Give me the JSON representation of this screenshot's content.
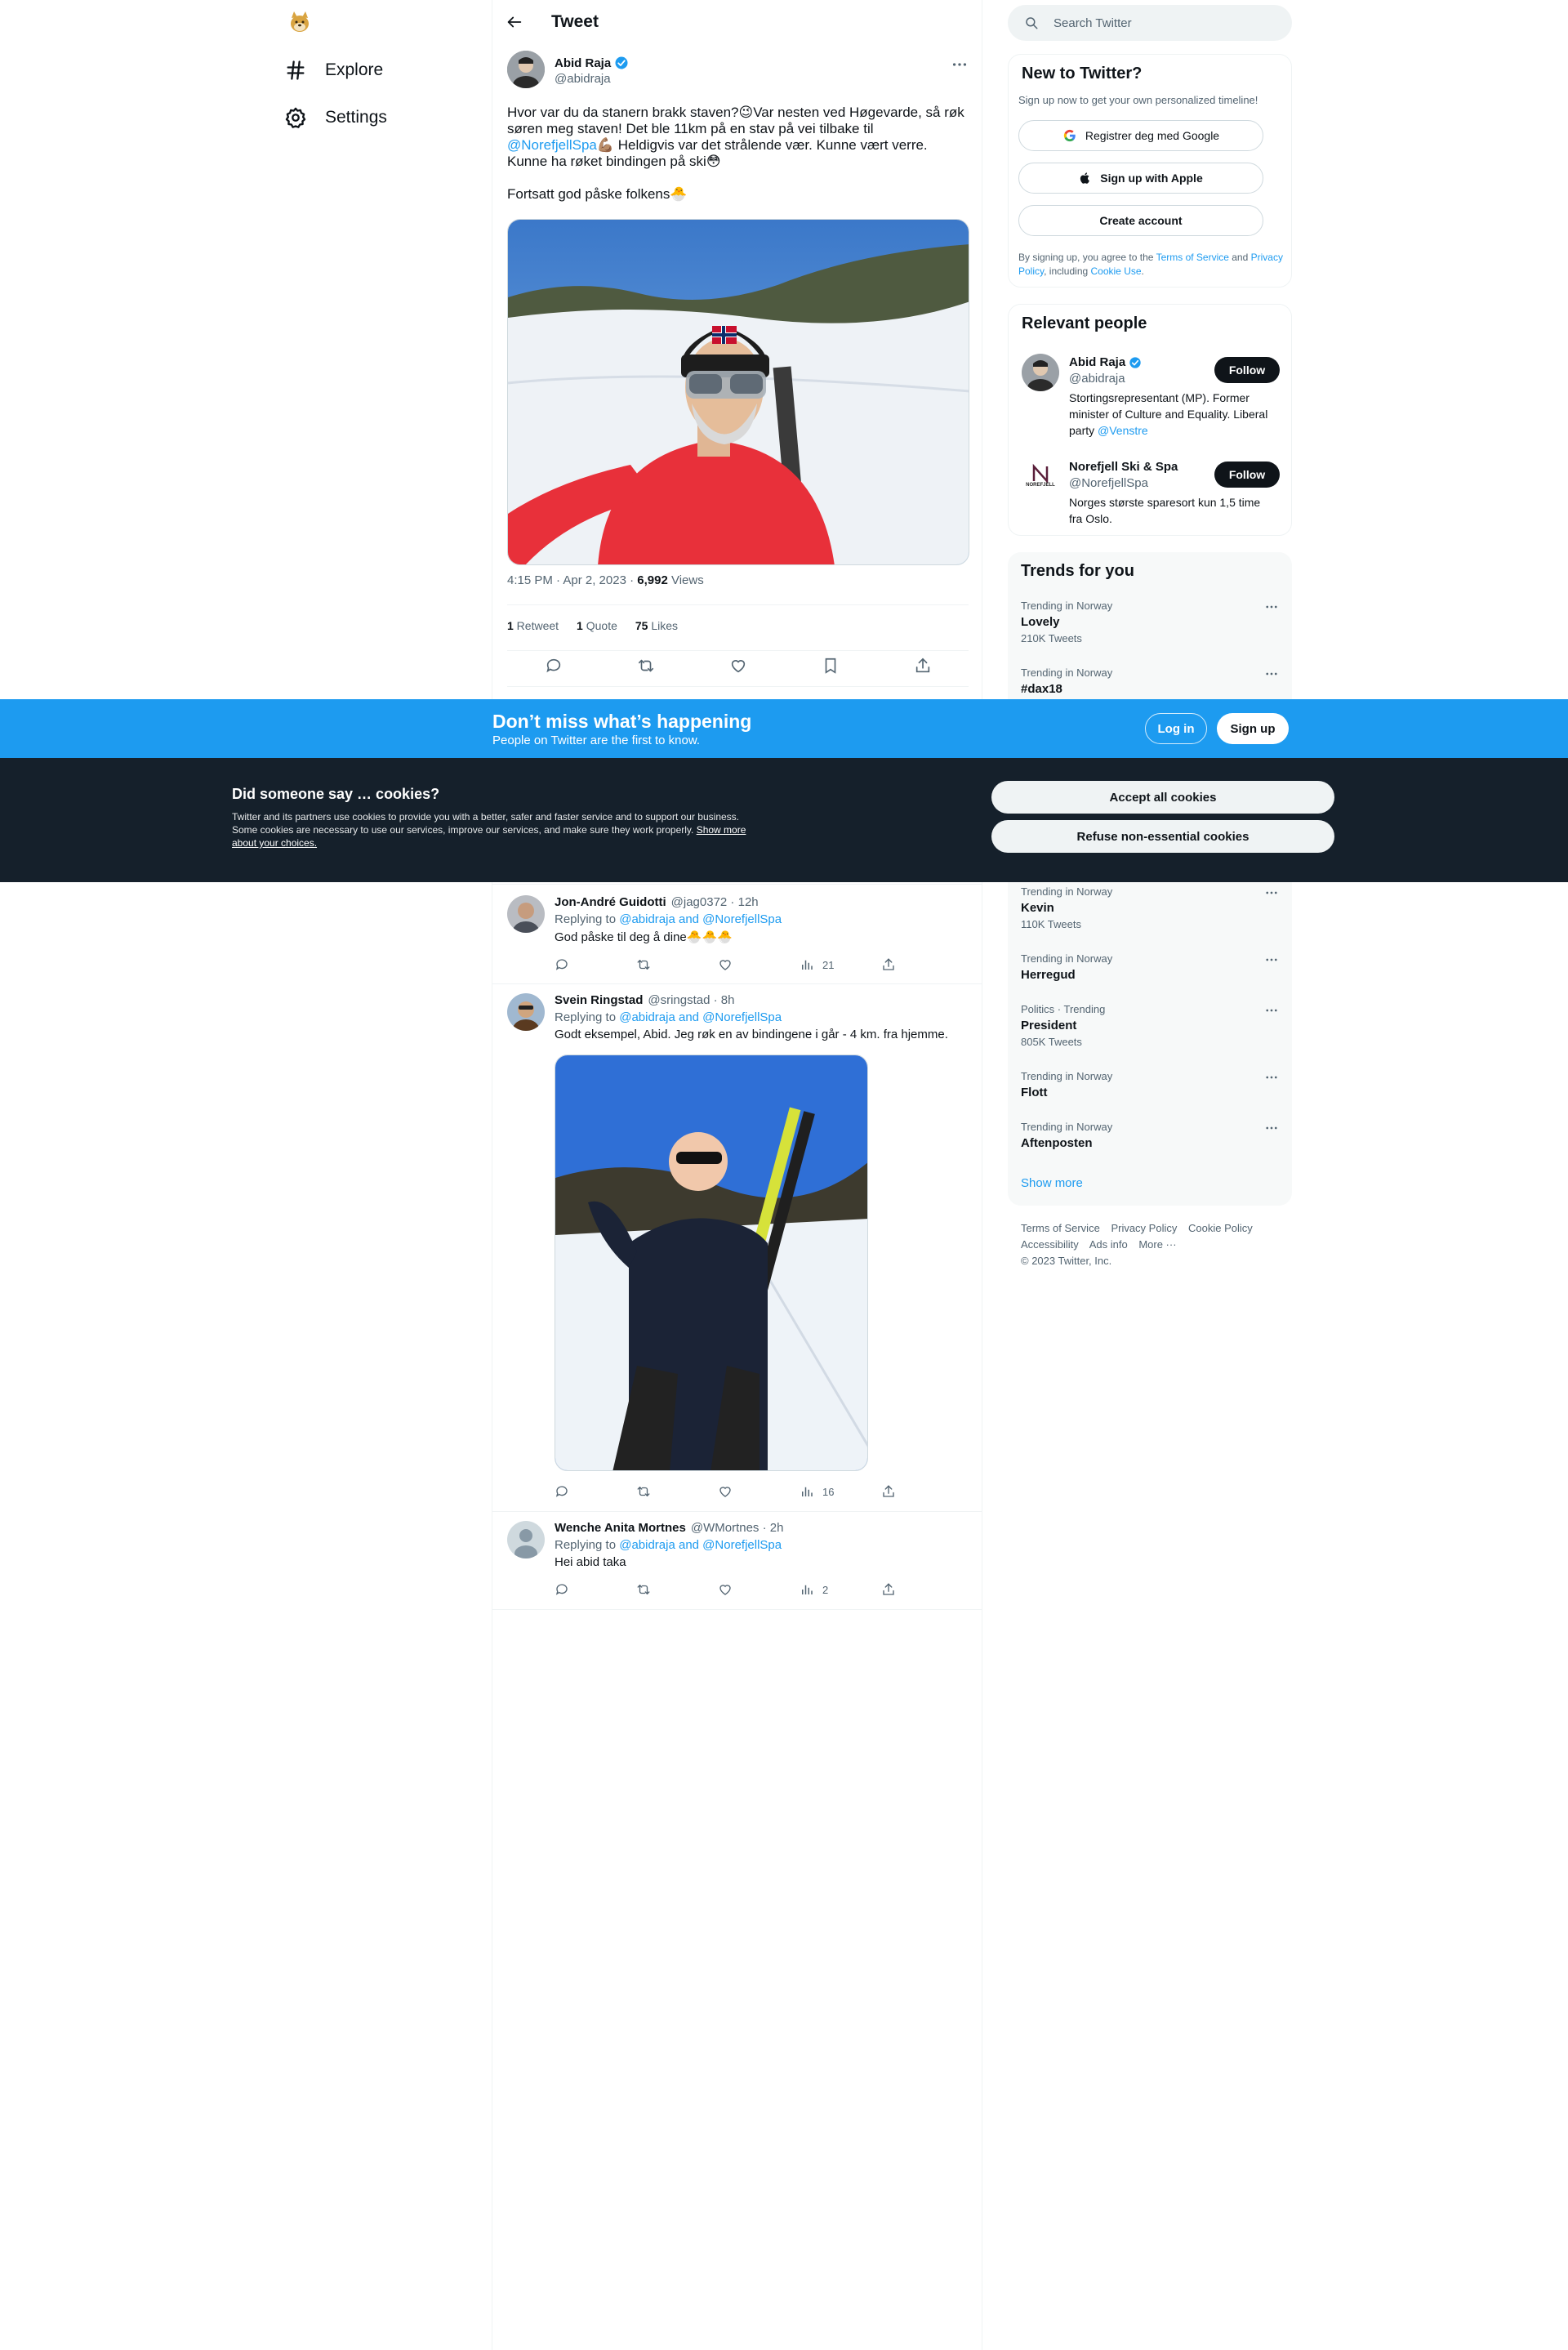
{
  "nav": {
    "explore": "Explore",
    "settings": "Settings"
  },
  "header": {
    "title": "Tweet"
  },
  "tweet": {
    "author_name": "Abid Raja",
    "author_handle": "@abidraja",
    "text_line1": "Hvor var du da stanern brakk staven?😉Var nesten ved Høgevarde, så røk søren meg staven! Det ble 11km på en stav på vei tilbake til",
    "mention": "@NorefjellSpa",
    "text_line2": "💪🏽 Heldigvis var det strålende vær. Kunne vært verre. Kunne ha røket bindingen på ski😳",
    "text_para2": "Fortsatt god påske folkens🐣",
    "timestamp": "4:15 PM · Apr 2, 2023 · ",
    "views_count": "6,992",
    "views_label": " Views",
    "retweets_count": "1",
    "retweets_label": " Retweet",
    "quotes_count": "1",
    "quotes_label": " Quote",
    "likes_count": "75",
    "likes_label": " Likes"
  },
  "replies": [
    {
      "name": "Jon-André Guidotti",
      "handle": "@jag0372 · 12h",
      "replying_prefix": "Replying to ",
      "replying_to": "@abidraja and @NorefjellSpa",
      "text": "God påske til deg å dine🐣🐣🐣",
      "views": "21"
    },
    {
      "name": "Svein Ringstad",
      "handle": "@sringstad · 8h",
      "replying_prefix": "Replying to ",
      "replying_to": "@abidraja and @NorefjellSpa",
      "text": "Godt eksempel, Abid. Jeg røk en av bindingene i går - 4 km. fra hjemme.",
      "views": "16"
    },
    {
      "name": "Wenche Anita Mortnes",
      "handle": "@WMortnes · 2h",
      "replying_prefix": "Replying to ",
      "replying_to": "@abidraja and @NorefjellSpa",
      "text": "Hei abid taka",
      "views": "2"
    }
  ],
  "search": {
    "placeholder": "Search Twitter"
  },
  "new_to_twitter": {
    "title": "New to Twitter?",
    "subtitle": "Sign up now to get your own personalized timeline!",
    "google": "Registrer deg med Google",
    "apple": "Sign up with Apple",
    "create": "Create account",
    "legal_prefix": "By signing up, you agree to the ",
    "terms": "Terms of Service",
    "and": " and ",
    "privacy": "Privacy Policy",
    "including": ", including ",
    "cookie": "Cookie Use",
    "period": "."
  },
  "relevant_people": {
    "title": "Relevant people",
    "people": [
      {
        "name": "Abid Raja",
        "handle": "@abidraja",
        "bio": "Stortingsrepresentant (MP). Former minister of Culture and Equality. Liberal party ",
        "bio_link": "@Venstre",
        "follow": "Follow"
      },
      {
        "name": "Norefjell Ski & Spa",
        "handle": "@NorefjellSpa",
        "bio": "Norges største sparesort kun 1,5 time fra Oslo.",
        "logo_text": "NOREFJELL",
        "follow": "Follow"
      }
    ]
  },
  "trends": {
    "title": "Trends for you",
    "items": [
      {
        "context": "Trending in Norway",
        "name": "Lovely",
        "count": "210K Tweets"
      },
      {
        "context": "Trending in Norway",
        "name": "#dax18",
        "count": ""
      },
      {
        "context": "Trending in Norway",
        "name": "Kevin",
        "count": "110K Tweets"
      },
      {
        "context": "Trending in Norway",
        "name": "Herregud",
        "count": ""
      },
      {
        "context": "Politics · Trending",
        "name": "President",
        "count": "805K Tweets"
      },
      {
        "context": "Trending in Norway",
        "name": "Flott",
        "count": ""
      },
      {
        "context": "Trending in Norway",
        "name": "Aftenposten",
        "count": ""
      }
    ],
    "show_more": "Show more"
  },
  "footer": {
    "terms": "Terms of Service",
    "privacy": "Privacy Policy",
    "cookie": "Cookie Policy",
    "accessibility": "Accessibility",
    "ads": "Ads info",
    "more": "More ···",
    "copyright": "© 2023 Twitter, Inc."
  },
  "signup_banner": {
    "title": "Don’t miss what’s happening",
    "subtitle": "People on Twitter are the first to know.",
    "login": "Log in",
    "signup": "Sign up"
  },
  "cookie_banner": {
    "title": "Did someone say … cookies?",
    "body": "Twitter and its partners use cookies to provide you with a better, safer and faster service and to support our business. Some cookies are necessary to use our services, improve our services, and make sure they work properly. ",
    "link": "Show more about your choices.",
    "accept": "Accept all cookies",
    "refuse": "Refuse non-essential cookies"
  },
  "colors": {
    "accent": "#1d9bf0",
    "text": "#0f1419",
    "muted": "#536471",
    "cookie_bg": "#15202b"
  }
}
